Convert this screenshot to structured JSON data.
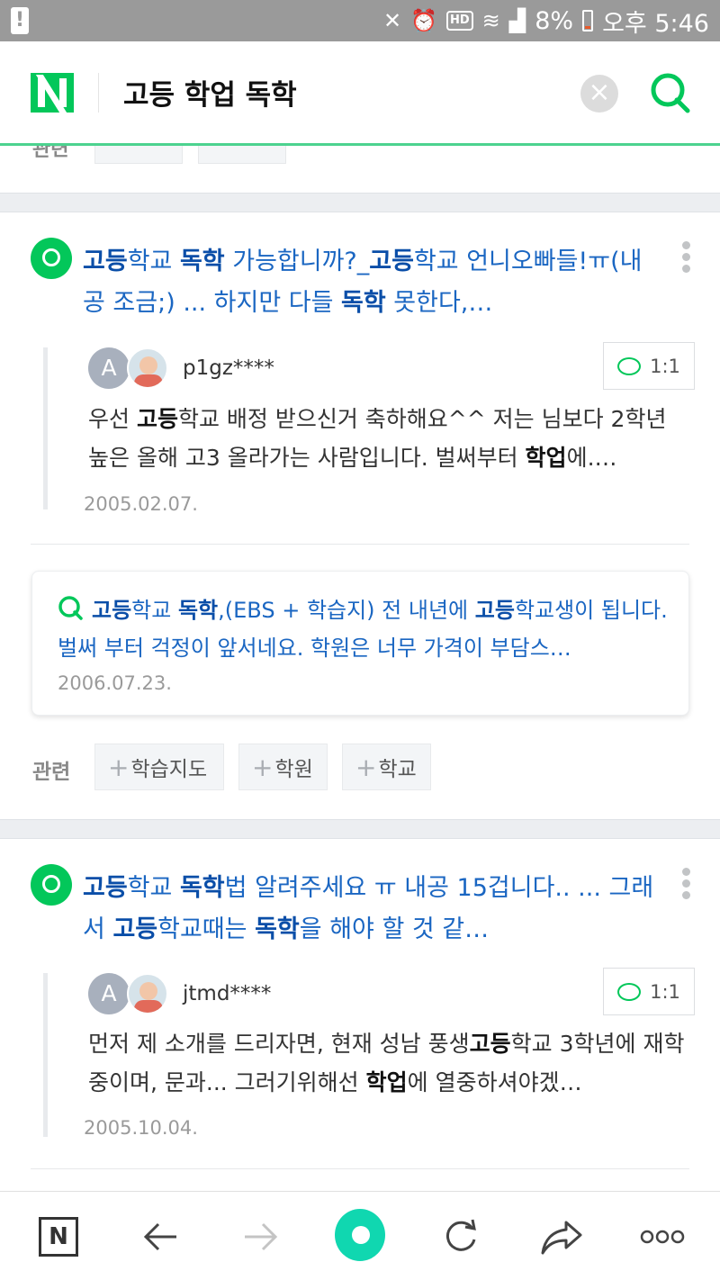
{
  "status_bar": {
    "battery": "8%",
    "time": "오후 5:46",
    "hd": "HD"
  },
  "header": {
    "logo": "N",
    "query": "고등 학업 독학"
  },
  "prev_related": {
    "label": "관련"
  },
  "results": [
    {
      "title_parts": [
        {
          "t": "고등",
          "b": true
        },
        {
          "t": "학교 ",
          "b": false
        },
        {
          "t": "독학",
          "b": true
        },
        {
          "t": " 가능합니까?_",
          "b": false
        },
        {
          "t": "고등",
          "b": true
        },
        {
          "t": "학교 언니오빠들!ㅠ(내공 조금;) ... 하지만 다들 ",
          "b": false
        },
        {
          "t": "독학",
          "b": true
        },
        {
          "t": " 못한다,…",
          "b": false
        }
      ],
      "answer": {
        "avatar_letter": "A",
        "user": "p1gz****",
        "chat_label": "1:1",
        "text_parts": [
          {
            "t": "우선 ",
            "b": false
          },
          {
            "t": "고등",
            "b": true
          },
          {
            "t": "학교 배정 받으신거 축하해요^^ 저는 님보다 2학년 높은 올해 고3 올라가는 사람입니다. 벌써부터 ",
            "b": false
          },
          {
            "t": "학업",
            "b": true
          },
          {
            "t": "에.…",
            "b": false
          }
        ],
        "date": "2005.02.07."
      },
      "related_question": {
        "text_parts": [
          {
            "t": "고등",
            "b": true
          },
          {
            "t": "학교 ",
            "b": false
          },
          {
            "t": "독학",
            "b": true
          },
          {
            "t": ",(EBS + 학습지) 전 내년에 ",
            "b": false
          },
          {
            "t": "고등",
            "b": true
          },
          {
            "t": "학교생이 됩니다. 벌써 부터 걱정이 앞서네요. 학원은 너무 가격이 부담스…",
            "b": false
          }
        ],
        "date": "2006.07.23."
      },
      "related_label": "관련",
      "tags": [
        "학습지도",
        "학원",
        "학교"
      ]
    },
    {
      "title_parts": [
        {
          "t": "고등",
          "b": true
        },
        {
          "t": "학교 ",
          "b": false
        },
        {
          "t": "독학",
          "b": true
        },
        {
          "t": "법 알려주세요 ㅠ 내공 15겁니다.. ... 그래서 ",
          "b": false
        },
        {
          "t": "고등",
          "b": true
        },
        {
          "t": "학교때는 ",
          "b": false
        },
        {
          "t": "독학",
          "b": true
        },
        {
          "t": "을 해야 할 것 같…",
          "b": false
        }
      ],
      "answer": {
        "avatar_letter": "A",
        "user": "jtmd****",
        "chat_label": "1:1",
        "text_parts": [
          {
            "t": "먼저 제 소개를 드리자면, 현재 성남 풍생",
            "b": false
          },
          {
            "t": "고등",
            "b": true
          },
          {
            "t": "학교 3학년에 재학중이며, 문과... 그러기위해선 ",
            "b": false
          },
          {
            "t": "학업",
            "b": true
          },
          {
            "t": "에 열중하셔야겠…",
            "b": false
          }
        ],
        "date": "2005.10.04."
      }
    }
  ],
  "colors": {
    "brand_green": "#03c75a",
    "link_blue": "#1a66c2",
    "header_line": "#4cd28f",
    "home_button": "#10d7b0"
  },
  "icons": {
    "clear": "close-icon",
    "search": "search-icon",
    "more": "more-vertical-icon",
    "chat": "chat-bubble-icon",
    "back": "arrow-left-icon",
    "forward": "arrow-right-icon",
    "reload": "reload-icon",
    "share": "share-icon",
    "menu": "more-horizontal-icon"
  }
}
